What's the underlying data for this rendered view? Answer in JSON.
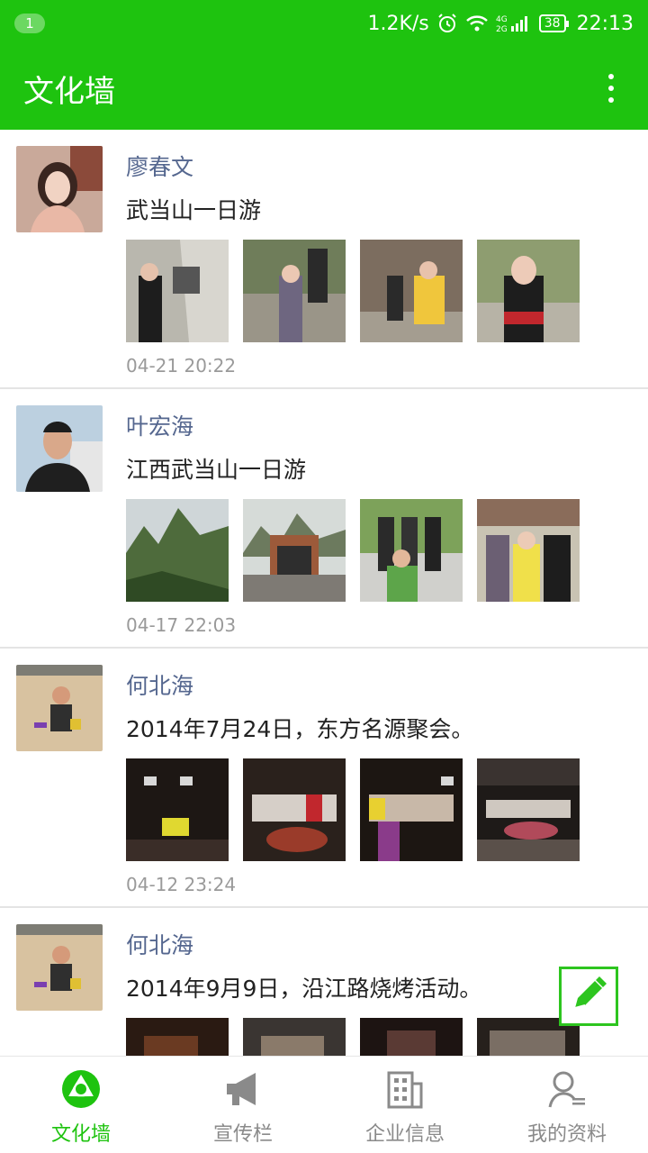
{
  "status_bar": {
    "notification_count": "1",
    "net_speed": "1.2K/s",
    "signal_label": "4G 2G",
    "battery": "38",
    "time": "22:13"
  },
  "app_bar": {
    "title": "文化墙"
  },
  "posts": [
    {
      "author": "廖春文",
      "text": "武当山一日游",
      "time": "04-21 20:22"
    },
    {
      "author": "叶宏海",
      "text": "江西武当山一日游",
      "time": "04-17 22:03"
    },
    {
      "author": "何北海",
      "text": "2014年7月24日，东方名源聚会。",
      "time": "04-12 23:24"
    },
    {
      "author": "何北海",
      "text": "2014年9月9日，沿江路烧烤活动。",
      "time": ""
    }
  ],
  "tabs": [
    {
      "label": "文化墙",
      "icon": "aperture-icon",
      "active": true
    },
    {
      "label": "宣传栏",
      "icon": "megaphone-icon",
      "active": false
    },
    {
      "label": "企业信息",
      "icon": "building-icon",
      "active": false
    },
    {
      "label": "我的资料",
      "icon": "user-profile-icon",
      "active": false
    }
  ],
  "colors": {
    "brand": "#1ec30f",
    "author": "#55678f",
    "timestamp": "#9a9a9a"
  }
}
